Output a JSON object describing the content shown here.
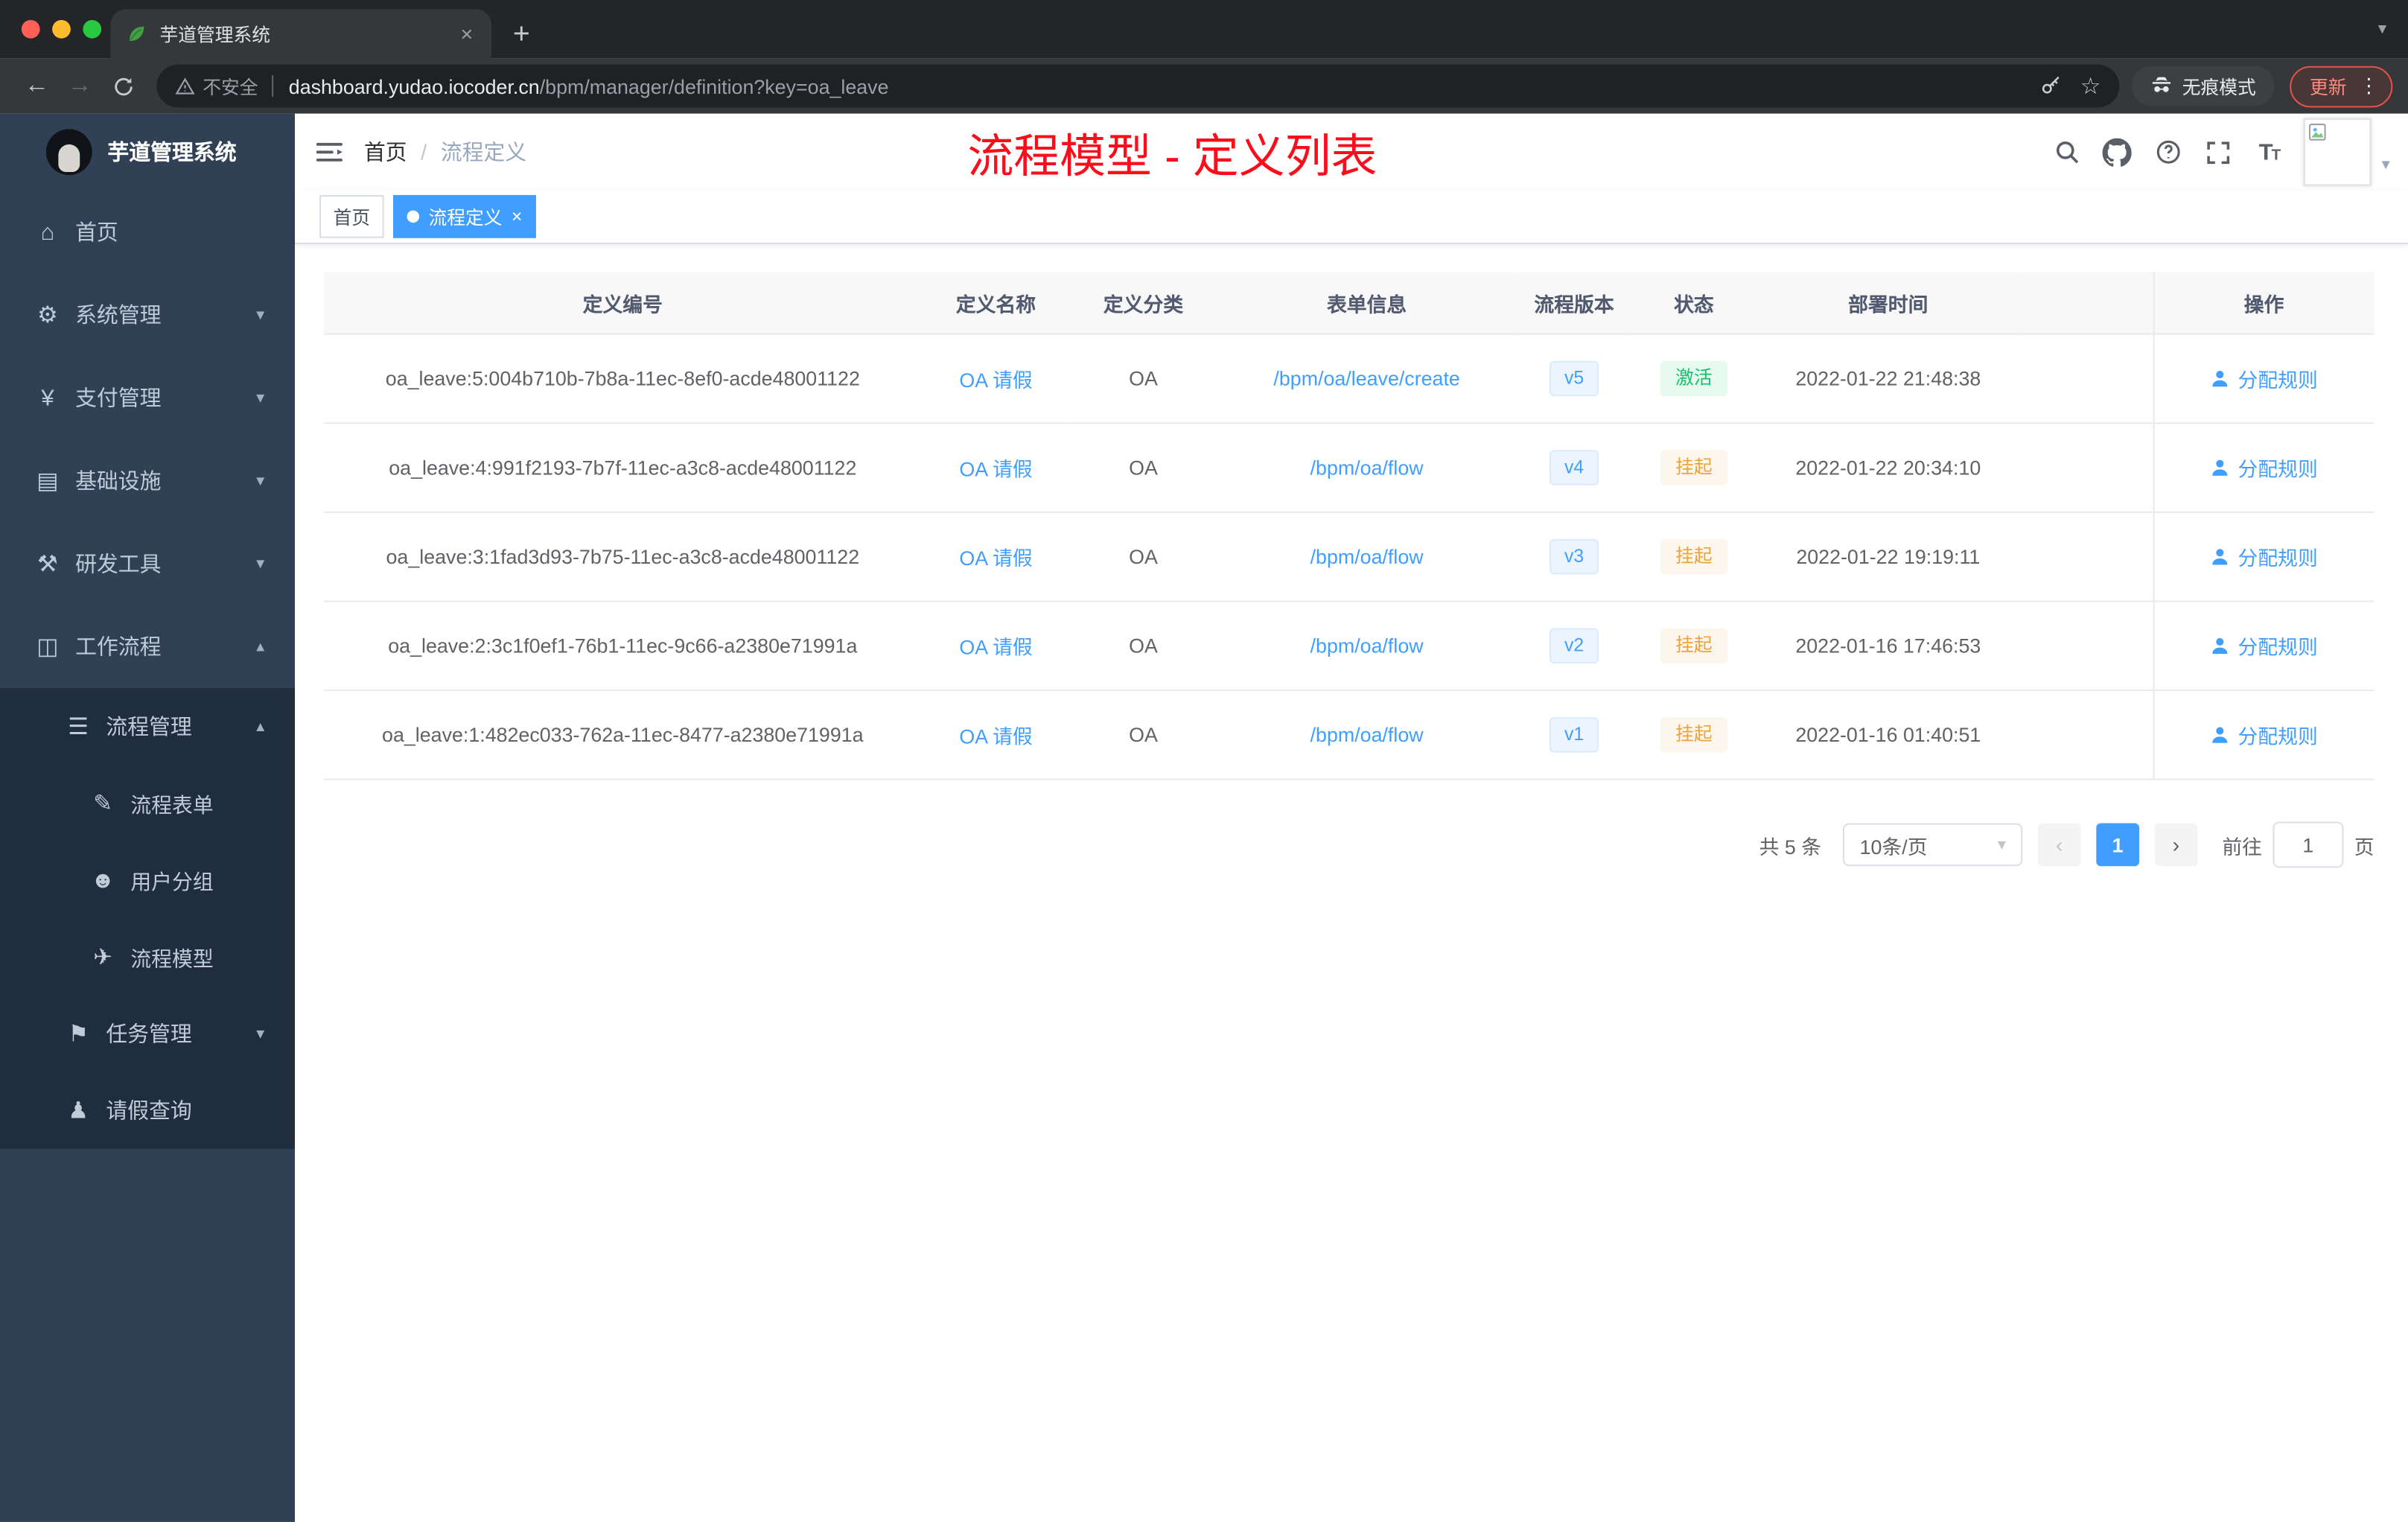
{
  "browser": {
    "tab_title": "芋道管理系统",
    "address": {
      "security": "不安全",
      "host": "dashboard.yudao.iocoder.cn",
      "path": "/bpm/manager/definition?key=oa_leave"
    },
    "incognito_label": "无痕模式",
    "update_label": "更新"
  },
  "sidebar": {
    "logo_title": "芋道管理系统",
    "items": [
      {
        "label": "首页",
        "icon": "home-icon",
        "glyph": "⌂",
        "level": 1
      },
      {
        "label": "系统管理",
        "icon": "gear-icon",
        "glyph": "⚙",
        "level": 1,
        "chevron": "down"
      },
      {
        "label": "支付管理",
        "icon": "yen-icon",
        "glyph": "¥",
        "level": 1,
        "chevron": "down"
      },
      {
        "label": "基础设施",
        "icon": "server-icon",
        "glyph": "▤",
        "level": 1,
        "chevron": "down"
      },
      {
        "label": "研发工具",
        "icon": "tools-icon",
        "glyph": "⚒",
        "level": 1,
        "chevron": "down"
      },
      {
        "label": "工作流程",
        "icon": "workflow-icon",
        "glyph": "◫",
        "level": 1,
        "chevron": "up"
      },
      {
        "label": "流程管理",
        "icon": "list-icon",
        "glyph": "☰",
        "level": 2,
        "chevron": "up",
        "dark": true
      },
      {
        "label": "流程表单",
        "icon": "form-icon",
        "glyph": "✎",
        "level": 3,
        "dark": true
      },
      {
        "label": "用户分组",
        "icon": "users-icon",
        "glyph": "☻",
        "level": 3,
        "dark": true
      },
      {
        "label": "流程模型",
        "icon": "plane-icon",
        "glyph": "✈",
        "level": 3,
        "dark": true
      },
      {
        "label": "任务管理",
        "icon": "task-icon",
        "glyph": "⚑",
        "level": 2,
        "chevron": "down",
        "dark": true
      },
      {
        "label": "请假查询",
        "icon": "person-icon",
        "glyph": "♟",
        "level": 2,
        "dark": true
      }
    ]
  },
  "navbar": {
    "breadcrumb": {
      "home": "首页",
      "separator": "/",
      "current": "流程定义"
    },
    "annotation": "流程模型 - 定义列表"
  },
  "tagsview": {
    "tags": [
      {
        "label": "首页",
        "active": false
      },
      {
        "label": "流程定义",
        "active": true
      }
    ]
  },
  "table": {
    "columns": [
      "定义编号",
      "定义名称",
      "定义分类",
      "表单信息",
      "流程版本",
      "状态",
      "部署时间",
      "操作"
    ],
    "rows": [
      {
        "id": "oa_leave:5:004b710b-7b8a-11ec-8ef0-acde48001122",
        "name": "OA 请假",
        "category": "OA",
        "form": "/bpm/oa/leave/create",
        "version": "v5",
        "status": "激活",
        "status_type": "success",
        "time": "2022-01-22 21:48:38",
        "action": "分配规则"
      },
      {
        "id": "oa_leave:4:991f2193-7b7f-11ec-a3c8-acde48001122",
        "name": "OA 请假",
        "category": "OA",
        "form": "/bpm/oa/flow",
        "version": "v4",
        "status": "挂起",
        "status_type": "warning",
        "time": "2022-01-22 20:34:10",
        "action": "分配规则"
      },
      {
        "id": "oa_leave:3:1fad3d93-7b75-11ec-a3c8-acde48001122",
        "name": "OA 请假",
        "category": "OA",
        "form": "/bpm/oa/flow",
        "version": "v3",
        "status": "挂起",
        "status_type": "warning",
        "time": "2022-01-22 19:19:11",
        "action": "分配规则"
      },
      {
        "id": "oa_leave:2:3c1f0ef1-76b1-11ec-9c66-a2380e71991a",
        "name": "OA 请假",
        "category": "OA",
        "form": "/bpm/oa/flow",
        "version": "v2",
        "status": "挂起",
        "status_type": "warning",
        "time": "2022-01-16 17:46:53",
        "action": "分配规则"
      },
      {
        "id": "oa_leave:1:482ec033-762a-11ec-8477-a2380e71991a",
        "name": "OA 请假",
        "category": "OA",
        "form": "/bpm/oa/flow",
        "version": "v1",
        "status": "挂起",
        "status_type": "warning",
        "time": "2022-01-16 01:40:51",
        "action": "分配规则"
      }
    ]
  },
  "pagination": {
    "total": "共 5 条",
    "page_size": "10条/页",
    "current_page": "1",
    "goto_label": "前往",
    "goto_value": "1",
    "page_unit": "页"
  },
  "colors": {
    "accent": "#409eff",
    "sidebar_bg": "#304156",
    "submenu_bg": "#1f2d3d",
    "success": "#19be6b",
    "warning": "#eda33c",
    "annotation_red": "#fc0d1b"
  }
}
